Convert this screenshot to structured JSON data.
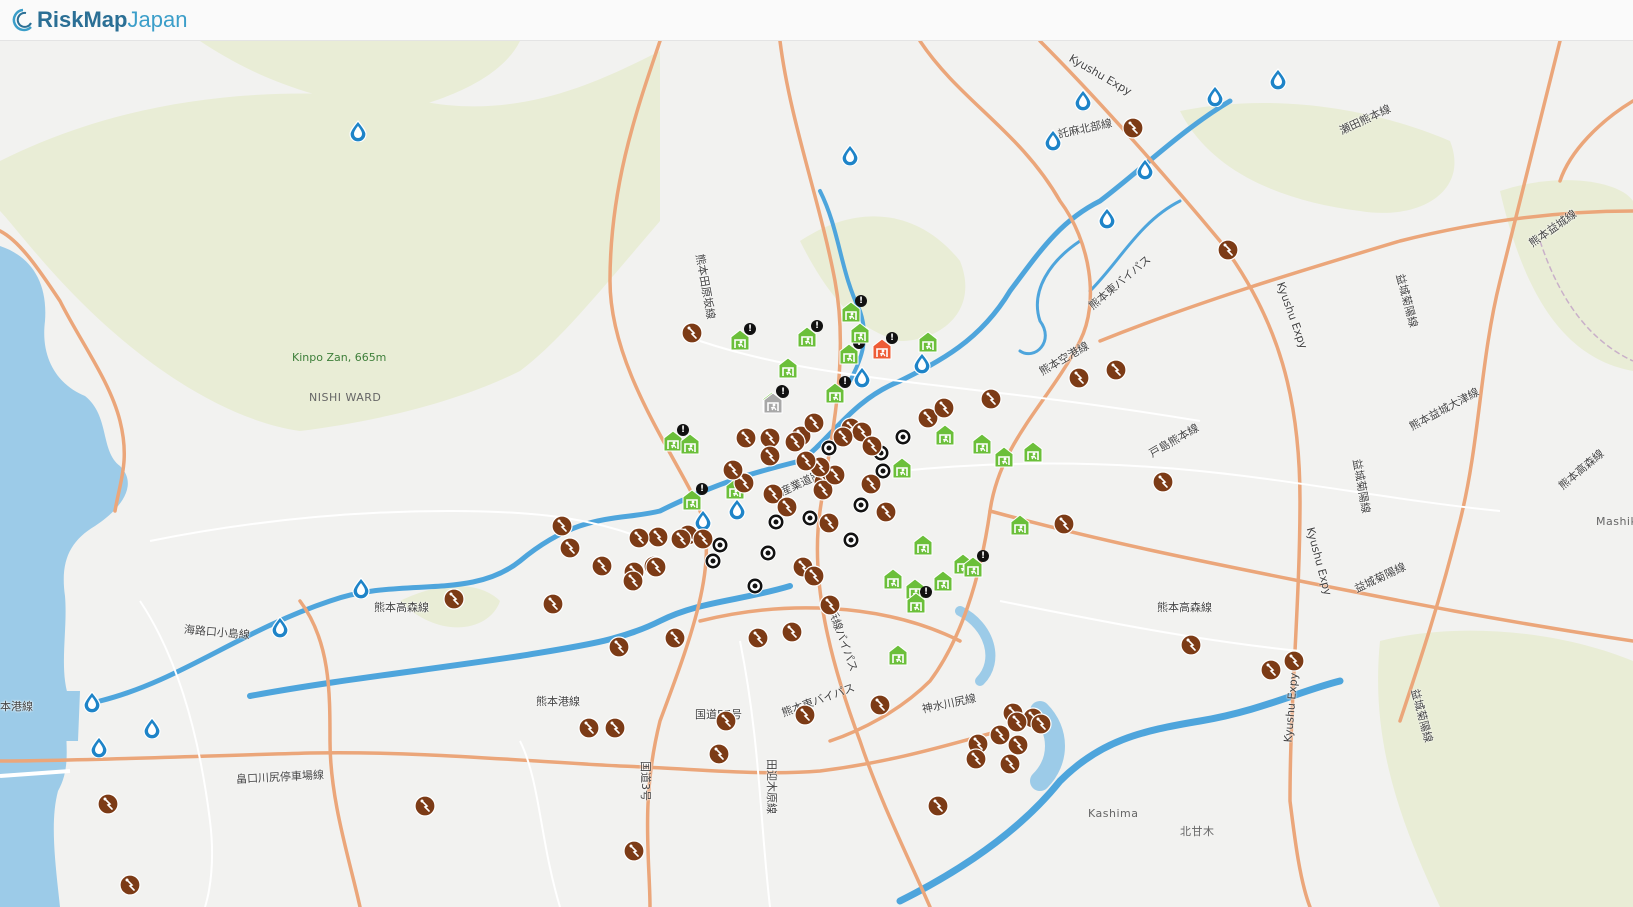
{
  "app": {
    "logo_part1": "RiskMap",
    "logo_part2": "Japan"
  },
  "colors": {
    "water": "#9ccbe8",
    "land": "#f2f2f0",
    "forest": "#e8ecd4",
    "highway": "#eba67a",
    "river": "#4ea5dc",
    "shelter": "#6bbf3a",
    "shelter_alert": "#ee5c36",
    "shelter_inactive": "#a8a8a8",
    "quake": "#7c3b16",
    "water_marker": "#1e84c8"
  },
  "map": {
    "place_labels": [
      "Kinpo Zan, 665m",
      "NISHI WARD",
      "Mashiki",
      "Kashima",
      "北甘木"
    ],
    "road_labels": [
      "Kyushu Expy",
      "託麻北部線",
      "熊本益城線",
      "瀬田熊本線",
      "熊本田原坂線",
      "熊本東バイパス",
      "熊本空港線",
      "戸島熊本線",
      "熊本益城大津線",
      "熊本高森線",
      "益城菊陽線",
      "熊本高森線",
      "熊本高森線",
      "海路口小島線",
      "熊本港線",
      "本港線",
      "熊本港線",
      "国道57号",
      "熊本東バイパス",
      "浜線バイパス",
      "産業道路",
      "田迎木原線",
      "神水川尻線",
      "国道3号",
      "畠口川尻停車場線",
      "Kyushu Expy",
      "Kyushu Expy",
      "Kyushu Expy",
      "益城菊陽線",
      "益城菊陽線",
      "益城菊陽線",
      "Kyushu Expy"
    ],
    "markers": {
      "evacuation_shelters": 34,
      "alerted_shelters": 1,
      "inactive_shelters": 1,
      "earthquake_reports": 86,
      "water_sources": 17,
      "target_points": 19
    }
  }
}
